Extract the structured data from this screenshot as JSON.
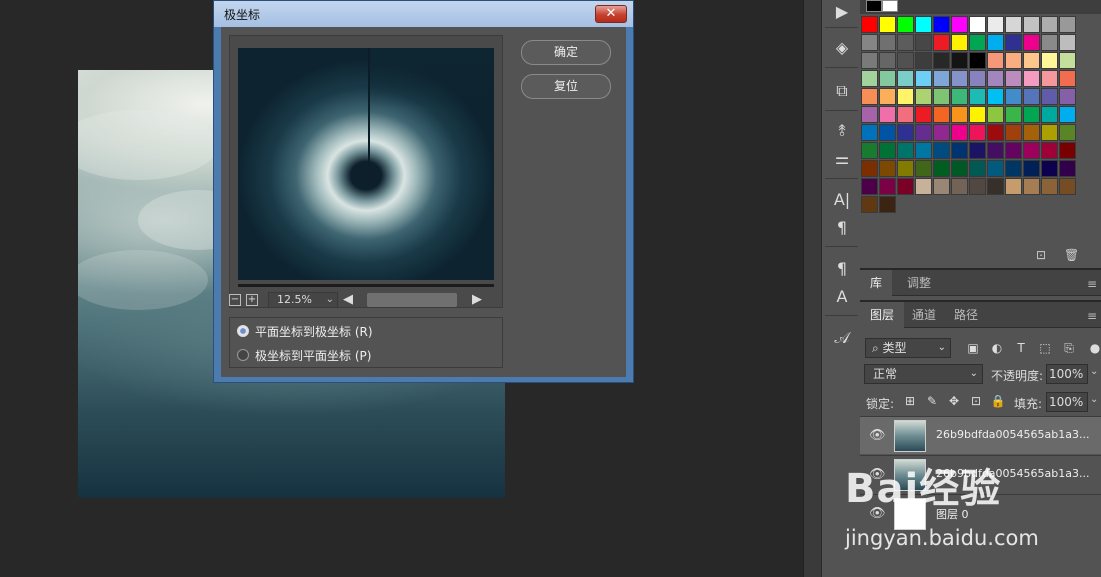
{
  "dialog": {
    "title": "极坐标",
    "ok_label": "确定",
    "reset_label": "复位",
    "zoom_value": "12.5%",
    "option_rect_to_polar": "平面坐标到极坐标 (R)",
    "option_polar_to_rect": "极坐标到平面坐标 (P)",
    "selected_option": "rect_to_polar"
  },
  "swatches": [
    [
      "#ff0000",
      "#ffff00",
      "#00ff00",
      "#00ffff",
      "#0000ff",
      "#ff00ff",
      "#ffffff",
      "#ebebeb",
      "#d6d6d6",
      "#c2c2c2",
      "#adadad",
      "#999999"
    ],
    [
      "#858585",
      "#707070",
      "#5c5c5c",
      "#474747",
      "#ed1c24",
      "#fff200",
      "#00a651",
      "#00aeef",
      "#2e3192",
      "#ec008c",
      "#8a8a8a",
      "#bdbdbd"
    ],
    [
      "#7a7a7a",
      "#666666",
      "#515151",
      "#3d3d3d",
      "#282828",
      "#141414",
      "#000000",
      "#f7977a",
      "#fbad82",
      "#fdc68c",
      "#fff799",
      "#c4df9b"
    ],
    [
      "#a3d39c",
      "#82ca9d",
      "#7bcdc8",
      "#6ecff6",
      "#7ea7d8",
      "#8493ca",
      "#8882be",
      "#a286bd",
      "#bc8cbf",
      "#f49bc1",
      "#f5989d",
      "#f26c4f"
    ],
    [
      "#f68e55",
      "#fbaf5a",
      "#fff467",
      "#acd372",
      "#7dc473",
      "#3cb878",
      "#1cbbb4",
      "#00bff3",
      "#438ccb",
      "#5574b9",
      "#605ca9",
      "#855fa8"
    ],
    [
      "#a763a9",
      "#f06ea9",
      "#f26d7d",
      "#ed1c24",
      "#f26522",
      "#f7941d",
      "#fff200",
      "#8dc63f",
      "#39b54a",
      "#00a651",
      "#00a99d",
      "#00aeef"
    ],
    [
      "#0072bc",
      "#0054a6",
      "#2e3192",
      "#662d91",
      "#92278f",
      "#ec008c",
      "#ed145b",
      "#9e0b0f",
      "#a0410d",
      "#a36209",
      "#aba000",
      "#598527"
    ],
    [
      "#197b30",
      "#007236",
      "#00746b",
      "#0076a3",
      "#004b80",
      "#003471",
      "#1b1464",
      "#440e62",
      "#630460",
      "#9e005d",
      "#9e0039",
      "#790000"
    ],
    [
      "#7b2e00",
      "#7d4900",
      "#827b00",
      "#406618",
      "#005e20",
      "#005826",
      "#005952",
      "#005b7f",
      "#003663",
      "#002157",
      "#0d004c",
      "#32004b"
    ],
    [
      "#4b0049",
      "#7b0046",
      "#7a0026",
      "#c7b299",
      "#998675",
      "#736357",
      "#534741",
      "#37302a",
      "#c69c6d",
      "#a67c52",
      "#8c6239",
      "#754c24"
    ],
    [
      "#603913",
      "#3c2415"
    ]
  ],
  "panels": {
    "tab_library": "库",
    "tab_adjust": "调整",
    "tab_layers": "图层",
    "tab_channels": "通道",
    "tab_paths": "路径",
    "filter_kind": "类型",
    "blend_mode": "正常",
    "opacity_label": "不透明度:",
    "opacity_value": "100%",
    "lock_label": "锁定:",
    "fill_label": "填充:",
    "fill_value": "100%"
  },
  "layers": [
    {
      "name": "26b9bdfda0054565ab1a3...",
      "selected": true
    },
    {
      "name": "26b9bdfda0054565ab1a3...",
      "selected": false
    },
    {
      "name": "图层 0",
      "selected": false
    }
  ],
  "watermark": {
    "brand": "Bai经验",
    "url": "jingyan.baidu.com"
  },
  "icons": {
    "play": "play-icon",
    "cube": "3d-icon",
    "history": "history-icon",
    "brush": "brush-icon",
    "sliders": "adjust-icon",
    "character": "character-icon",
    "paragraph": "paragraph-icon",
    "glyphs": "glyphs-icon"
  }
}
